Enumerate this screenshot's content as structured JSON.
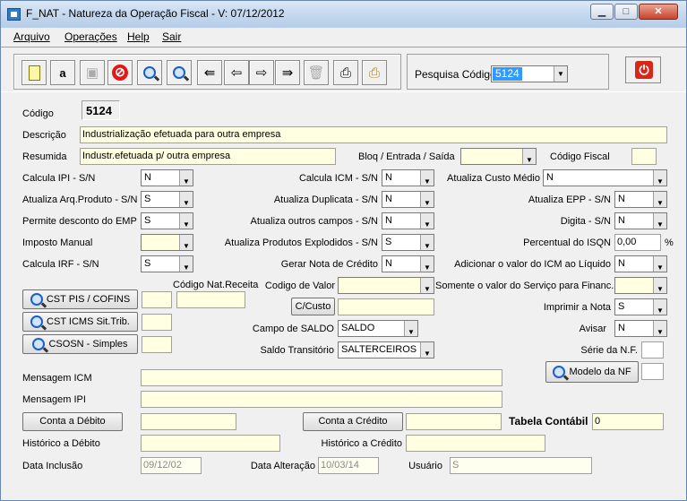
{
  "window": {
    "title": "F_NAT - Natureza da Operação Fiscal - V: 07/12/2012"
  },
  "menu": [
    "Arquivo",
    "Operações",
    "Help",
    "Sair"
  ],
  "toolbar": {
    "icons": [
      "new-icon",
      "spellcheck-icon",
      "save-icon",
      "cancel-icon",
      "search-icon",
      "search-alt-icon",
      "first-icon",
      "prev-icon",
      "next-icon",
      "last-icon",
      "delete-icon",
      "print-icon",
      "print-alt-icon"
    ]
  },
  "search": {
    "label": "Pesquisa Código",
    "value": "5124"
  },
  "form": {
    "codigo_label": "Código",
    "codigo": "5124",
    "descricao_label": "Descrição",
    "descricao": "Industrialização efetuada para outra empresa",
    "resumida_label": "Resumida",
    "resumida": "Industr.efetuada p/ outra empresa",
    "bloq_label": "Bloq / Entrada / Saída",
    "bloq": "",
    "codigo_fiscal_label": "Código Fiscal",
    "codigo_fiscal": "",
    "calcula_ipi_label": "Calcula IPI - S/N",
    "calcula_ipi": "N",
    "calcula_icm_label": "Calcula ICM - S/N",
    "calcula_icm": "N",
    "atualiza_custo_label": "Atualiza Custo Médio",
    "atualiza_custo": "N",
    "atualiza_arq_label": "Atualiza Arq.Produto - S/N",
    "atualiza_arq": "S",
    "atualiza_dup_label": "Atualiza Duplicata - S/N",
    "atualiza_dup": "N",
    "atualiza_epp_label": "Atualiza EPP - S/N",
    "atualiza_epp": "N",
    "permite_desc_label": "Permite desconto do EMP",
    "permite_desc": "S",
    "atualiza_outros_label": "Atualiza outros campos - S/N",
    "atualiza_outros": "N",
    "digita_label": "Digita - S/N",
    "digita": "N",
    "imposto_manual_label": "Imposto Manual",
    "imposto_manual": "",
    "atualiza_explod_label": "Atualiza Produtos Explodidos - S/N",
    "atualiza_explod": "S",
    "percentual_isqn_label": "Percentual do ISQN",
    "percentual_isqn": "0,00",
    "pct": "%",
    "calcula_irf_label": "Calcula IRF - S/N",
    "calcula_irf": "S",
    "gerar_nota_label": "Gerar Nota de Crédito",
    "gerar_nota": "N",
    "adicionar_icm_label": "Adicionar o valor do ICM ao Líquido",
    "adicionar_icm": "N",
    "cst_pis_btn": "CST PIS / COFINS",
    "cst_icms_btn": "CST ICMS Sit.Trib.",
    "csosn_btn": "CSOSN - Simples",
    "cod_nat_receita_label": "Código Nat.Receita",
    "codigo_valor_label": "Codigo de Valor",
    "codigo_valor": "",
    "somente_valor_label": "Somente o valor do Serviço para Financ.",
    "somente_valor": "",
    "ccusto_btn": "C/Custo",
    "ccusto": "",
    "imprimir_nota_label": "Imprimir a Nota",
    "imprimir_nota": "S",
    "campo_saldo_label": "Campo de SALDO",
    "campo_saldo": "SALDO",
    "avisar_label": "Avisar",
    "avisar": "N",
    "saldo_transitorio_label": "Saldo Transitório",
    "saldo_transitorio": "SALTERCEIROS",
    "serie_nf_label": "Série da N.F.",
    "serie_nf": "",
    "modelo_nf_btn": "Modelo da NF",
    "modelo_nf": "",
    "mensagem_icm_label": "Mensagem ICM",
    "mensagem_icm": "",
    "mensagem_ipi_label": "Mensagem IPI",
    "mensagem_ipi": "",
    "conta_debito_btn": "Conta a Débito",
    "conta_debito": "",
    "conta_credito_btn": "Conta a Crédito",
    "conta_credito": "",
    "tabela_contabil_label": "Tabela Contábil",
    "tabela_contabil": "0",
    "historico_debito_label": "Histórico a Débito",
    "historico_debito": "",
    "historico_credito_label": "Histórico a Crédito",
    "historico_credito": "",
    "data_inclusao_label": "Data Inclusão",
    "data_inclusao": "09/12/02",
    "data_alteracao_label": "Data Alteração",
    "data_alteracao": "10/03/14",
    "usuario_label": "Usuário",
    "usuario": "S"
  }
}
